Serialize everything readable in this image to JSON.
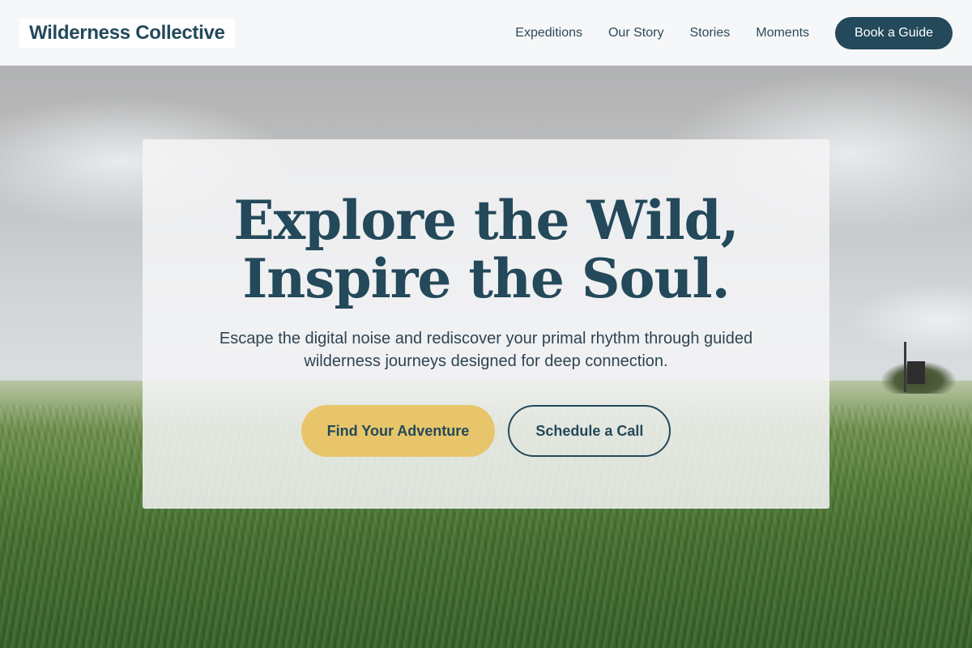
{
  "header": {
    "logo": "Wilderness Collective",
    "nav": [
      {
        "label": "Expeditions"
      },
      {
        "label": "Our Story"
      },
      {
        "label": "Stories"
      },
      {
        "label": "Moments"
      }
    ],
    "cta_label": "Book a Guide"
  },
  "hero": {
    "headline_line1": "Explore the Wild,",
    "headline_line2": "Inspire the Soul.",
    "subtext": "Escape the digital noise and rediscover your primal rhythm through guided wilderness journeys designed for deep connection.",
    "primary_cta": "Find Your Adventure",
    "secondary_cta": "Schedule a Call"
  },
  "colors": {
    "brand_dark": "#23495a",
    "accent_gold": "#e8c56a"
  }
}
